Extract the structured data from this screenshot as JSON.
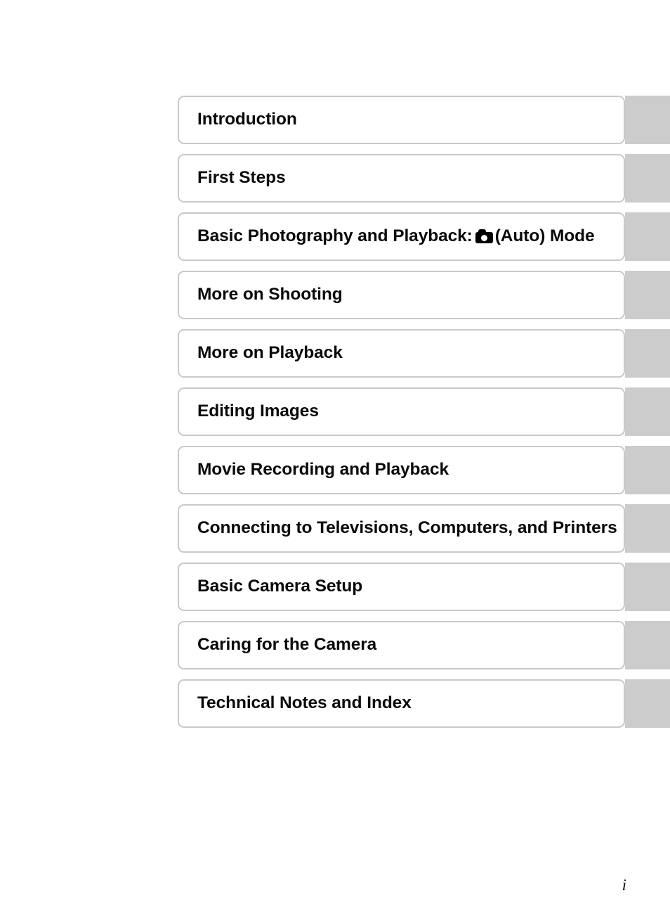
{
  "page": {
    "page_number": "i",
    "background_color": "#ffffff"
  },
  "theme": {
    "box_border_color": "#c9c9c9",
    "tab_color": "#cccccc",
    "text_color": "#0a0a0a"
  },
  "chapter_index": {
    "items": [
      {
        "title": "Introduction",
        "icon": null
      },
      {
        "title": "First Steps",
        "icon": null
      },
      {
        "title_before_icon": "Basic Photography and Playback:",
        "icon": "camera-icon",
        "title_after_icon": "(Auto) Mode",
        "title": "Basic Photography and Playback: (Auto) Mode"
      },
      {
        "title": "More on Shooting",
        "icon": null
      },
      {
        "title": "More on Playback",
        "icon": null
      },
      {
        "title": "Editing Images",
        "icon": null
      },
      {
        "title": "Movie Recording and Playback",
        "icon": null
      },
      {
        "title": "Connecting to Televisions, Computers, and Printers",
        "icon": null
      },
      {
        "title": "Basic Camera Setup",
        "icon": null
      },
      {
        "title": "Caring for the Camera",
        "icon": null
      },
      {
        "title": "Technical Notes and Index",
        "icon": null
      }
    ]
  }
}
